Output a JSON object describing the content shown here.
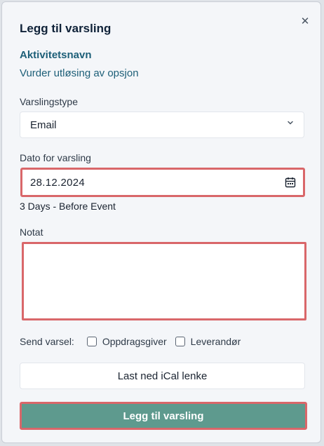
{
  "dialog": {
    "title": "Legg til varsling",
    "close_icon": "close-icon",
    "activity_name": "Aktivitetsnavn",
    "activity_sub": "Vurder utløsing av opsjon"
  },
  "notification_type": {
    "label": "Varslingstype",
    "value": "Email",
    "icon": "chevron-down-icon"
  },
  "date": {
    "label": "Dato for varsling",
    "value": "28.12.2024",
    "icon": "calendar-icon",
    "hint": "3 Days - Before Event"
  },
  "note": {
    "label": "Notat",
    "value": ""
  },
  "send": {
    "label": "Send varsel:",
    "options": [
      {
        "label": "Oppdragsgiver",
        "checked": false
      },
      {
        "label": "Leverandør",
        "checked": false
      }
    ]
  },
  "buttons": {
    "ical": "Last ned iCal lenke",
    "submit": "Legg til varsling"
  },
  "colors": {
    "primary": "#5e9a8e",
    "highlight_border": "#d9676a",
    "heading": "#0f2238",
    "accent_text": "#1d5f78"
  }
}
